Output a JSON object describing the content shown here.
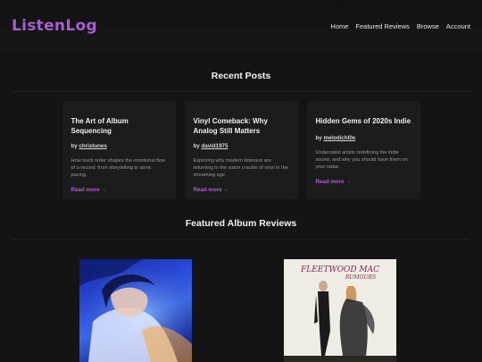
{
  "header": {
    "logo": "ListenLog",
    "nav": [
      "Home",
      "Featured Reviews",
      "Browse",
      "Account"
    ]
  },
  "recent": {
    "title": "Recent Posts",
    "posts": [
      {
        "title": "The Art of Album Sequencing",
        "by": "by",
        "author": "christunes",
        "excerpt": "How track order shapes the emotional flow of a record: from storytelling to sonic pacing.",
        "link": "Read more →"
      },
      {
        "title": "Vinyl Comeback: Why Analog Still Matters",
        "by": "by",
        "author": "david1975",
        "excerpt": "Exploring why modern listeners are returning to the warm crackle of vinyl in the streaming age.",
        "link": "Read more →"
      },
      {
        "title": "Hidden Gems of 2020s Indie",
        "by": "by",
        "author": "melodichl0e",
        "excerpt": "Underrated artists redefining the indie sound, and why you should have them on your radar.",
        "link": "Read more →"
      }
    ]
  },
  "featured": {
    "title": "Featured Album Reviews",
    "albums": [
      {
        "cover_text": ""
      },
      {
        "cover_text": "FLEETWOOD MAC",
        "cover_subtext": "RUMOURS"
      }
    ]
  },
  "colors": {
    "accent": "#a65fd1",
    "background": "#141414",
    "card": "#1c1c1c"
  }
}
